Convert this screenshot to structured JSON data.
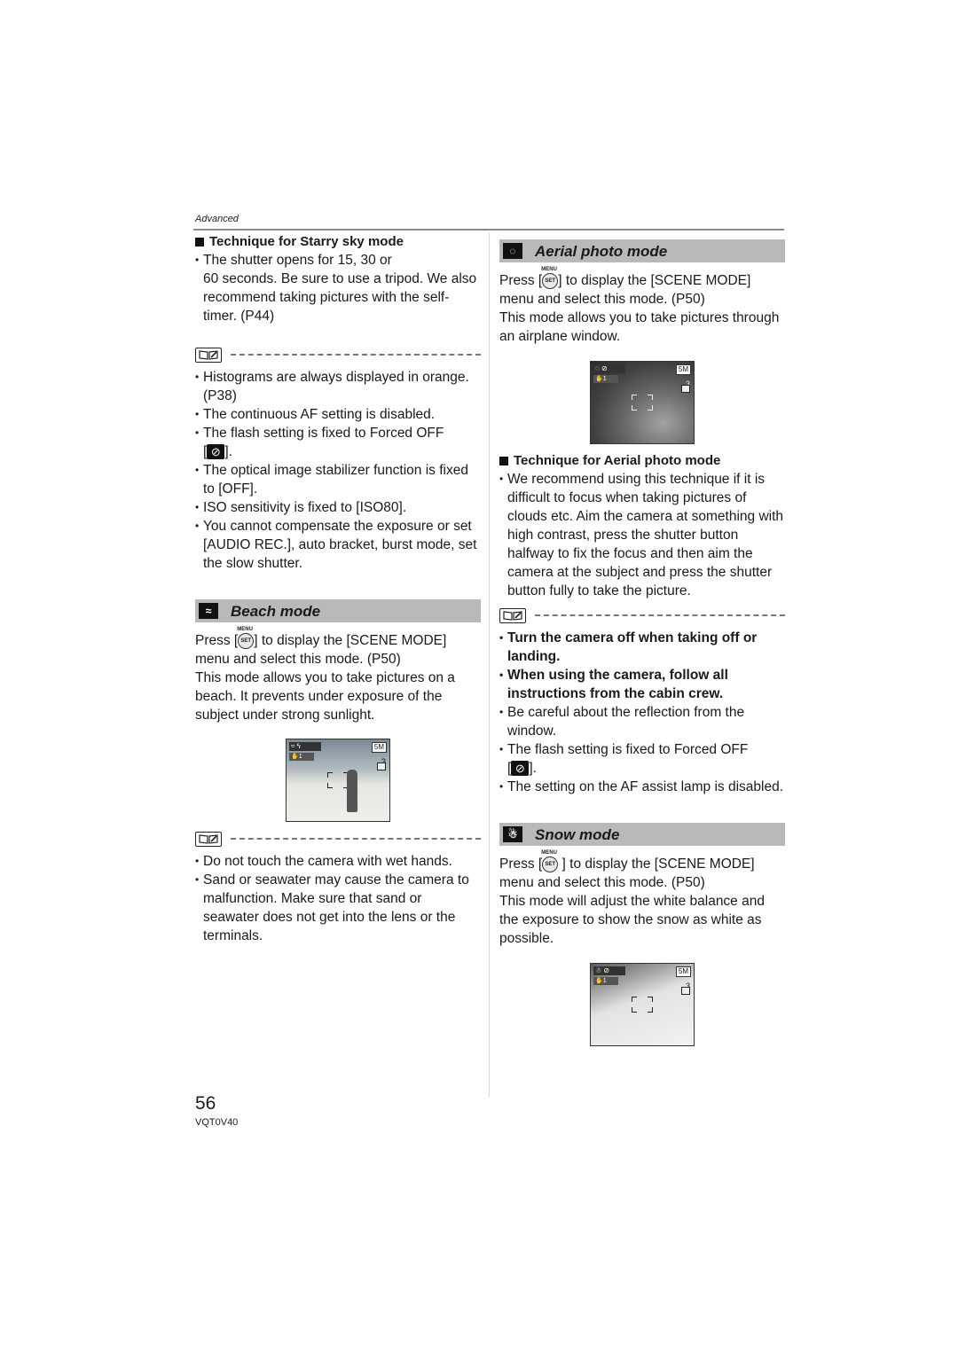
{
  "header": {
    "running_head": "Advanced"
  },
  "left_column": {
    "starry_technique": {
      "heading": "Technique for Starry sky mode",
      "items": [
        "The shutter opens for 15, 30 or\n60 seconds. Be sure to use a tripod. We also recommend taking pictures with the self-timer. (P44)"
      ]
    },
    "starry_notes": [
      "Histograms are always displayed in orange. (P38)",
      "The continuous AF setting is disabled.",
      "The flash setting is fixed to Forced OFF",
      "The optical image stabilizer function is fixed to [OFF].",
      "ISO sensitivity is fixed to [ISO80].",
      "You cannot compensate the exposure or set [AUDIO REC.], auto bracket, burst mode, set the slow shutter."
    ],
    "beach": {
      "title": "Beach mode",
      "icon": "beach-icon",
      "press_pre": "Press [",
      "press_post": "] to display the [SCENE MODE] menu and select this mode. (P50)",
      "description": "This mode allows you to take pictures on a beach. It prevents under exposure of the subject under strong sunlight.",
      "screen": {
        "count": "3",
        "hud_quality": "5M"
      },
      "notes": [
        "Do not touch the camera with wet hands.",
        "Sand or seawater may cause the camera to malfunction. Make sure that sand or seawater does not get into the lens or the terminals."
      ]
    }
  },
  "right_column": {
    "aerial": {
      "title": "Aerial photo mode",
      "icon": "aerial-icon",
      "press_pre": "Press [",
      "press_post": "] to display the [SCENE MODE] menu and select this mode. (P50)",
      "description": "This mode allows you to take pictures through an airplane window.",
      "screen": {
        "count": "3",
        "hud_quality": "5M"
      },
      "technique_heading": "Technique for Aerial photo mode",
      "technique_items": [
        "We recommend using this technique if it is difficult to focus when taking pictures of clouds etc. Aim the camera at something with high contrast, press the shutter button halfway to fix the focus and then aim the camera at the subject and press the shutter button fully to take the picture."
      ],
      "notes_bold": [
        "Turn the camera off when taking off or landing.",
        "When using the camera, follow all instructions from the cabin crew."
      ],
      "notes": [
        "Be careful about the reflection from the window.",
        "The flash setting is fixed to Forced OFF",
        "The setting on the AF assist lamp is disabled."
      ]
    },
    "snow": {
      "title": "Snow mode",
      "icon": "snow-icon",
      "press_pre": "Press [",
      "press_post": " ] to display the [SCENE MODE] menu and select this mode. (P50)",
      "description": "This mode will adjust the white balance and the exposure to show the snow as white as possible.",
      "screen": {
        "count": "3",
        "hud_quality": "5M"
      }
    }
  },
  "common": {
    "set_label": "SET",
    "bracket_close": "].",
    "bracket_open": "["
  },
  "footer": {
    "page_number": "56",
    "doc_code": "VQT0V40"
  }
}
